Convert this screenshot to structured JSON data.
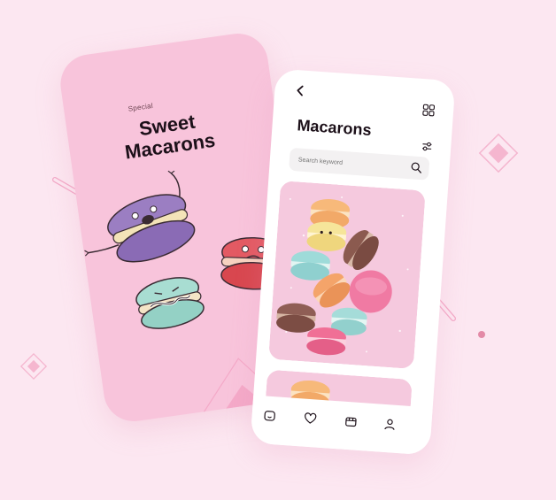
{
  "colors": {
    "background": "#fce7f1",
    "left_phone": "#f8c4db",
    "right_phone": "#ffffff",
    "search_bg": "#f3f1f2",
    "text_dark": "#1c1019",
    "accent_pink": "#f29abd"
  },
  "intro_screen": {
    "eyebrow": "Special",
    "title_line1": "Sweet",
    "title_line2": "Macarons"
  },
  "list_screen": {
    "title": "Macarons",
    "search": {
      "placeholder": "Search keyword",
      "value": ""
    },
    "icons": {
      "back": "chevron-left-icon",
      "layout": "grid-icon",
      "filter": "sliders-icon",
      "search": "search-icon"
    },
    "cards": [
      "macaron-photo-card",
      "macaron-photo-card"
    ],
    "tabbar": [
      "home-icon",
      "heart-icon",
      "store-icon",
      "profile-icon"
    ]
  }
}
